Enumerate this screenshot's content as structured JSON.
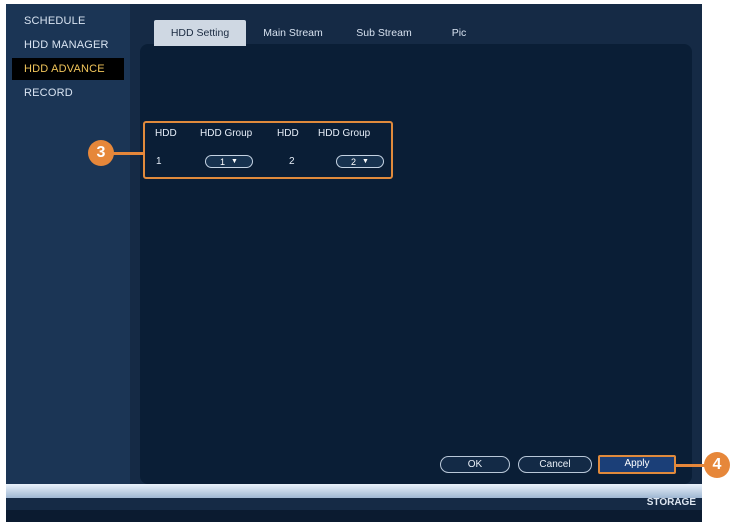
{
  "sidebar": {
    "items": [
      {
        "label": "SCHEDULE",
        "active": false
      },
      {
        "label": "HDD MANAGER",
        "active": false
      },
      {
        "label": "HDD ADVANCE",
        "active": true
      },
      {
        "label": "RECORD",
        "active": false
      }
    ]
  },
  "tabs": [
    {
      "label": "HDD Setting",
      "active": true
    },
    {
      "label": "Main Stream",
      "active": false
    },
    {
      "label": "Sub Stream",
      "active": false
    },
    {
      "label": "Pic",
      "active": false
    }
  ],
  "hdd_table": {
    "headers": [
      "HDD",
      "HDD Group",
      "HDD",
      "HDD Group"
    ],
    "rows": [
      {
        "hdd1": "1",
        "group1": "1",
        "hdd2": "2",
        "group2": "2"
      }
    ]
  },
  "buttons": {
    "ok": "OK",
    "cancel": "Cancel",
    "apply": "Apply"
  },
  "footer": {
    "label": "STORAGE"
  },
  "callouts": {
    "step3": "3",
    "step4": "4"
  },
  "colors": {
    "accent_orange": "#e08a3c",
    "active_tab": "#cfd8e3",
    "panel_bg": "#0a1e36",
    "active_sidebar_text": "#f1c55a"
  }
}
